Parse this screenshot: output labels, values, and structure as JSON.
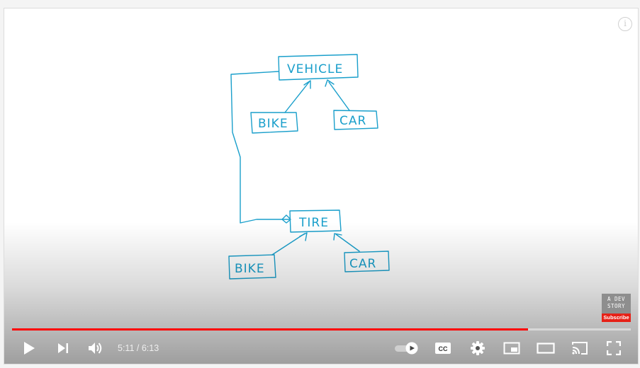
{
  "player": {
    "current_time": "5:11",
    "separator": "/",
    "duration": "6:13",
    "progress": 0.8338,
    "accent_color": "#ff0000"
  },
  "sketch": {
    "labels": {
      "vehicle": "VEHICLE",
      "bike_top": "BIKE",
      "car_top": "CAR",
      "tire": "TIRE",
      "bike_bottom": "BIKE",
      "car_bottom": "CAR"
    },
    "ink_color": "#1a9fcb"
  },
  "watermark": {
    "line1": "A DEV",
    "line2": "STORY",
    "subscribe": "Subscribe"
  },
  "icons": {
    "info": "i",
    "play": "play-icon",
    "next": "next-icon",
    "volume": "volume-icon",
    "autoplay": "autoplay-toggle-icon",
    "captions": "captions-icon",
    "settings": "settings-gear-icon",
    "miniplayer": "miniplayer-icon",
    "theater": "theater-mode-icon",
    "cast": "cast-icon",
    "fullscreen": "fullscreen-icon"
  }
}
